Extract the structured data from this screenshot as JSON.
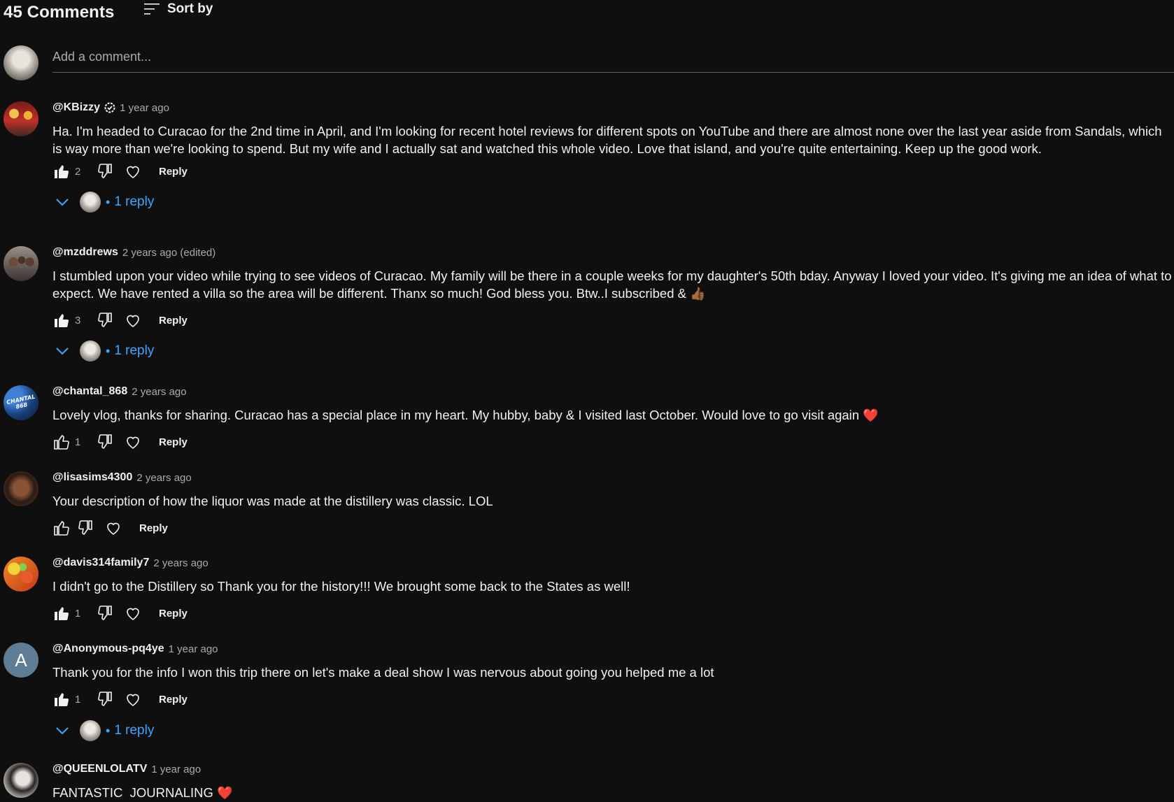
{
  "header": {
    "count_label": "45 Comments",
    "sort_label": "Sort by"
  },
  "add_comment": {
    "placeholder": "Add a comment..."
  },
  "comments": [
    {
      "author": "@KBizzy",
      "verified": true,
      "time": "1 year ago",
      "text": "Ha. I'm headed to Curacao for the 2nd time in April, and I'm looking for recent hotel reviews for different spots on YouTube and there are almost none over the last year aside from Sandals, which is way more than we're looking to spend. But my wife and I actually sat and watched this whole video. Love that island, and you're quite entertaining. Keep up the good work.",
      "likes": "2",
      "liked": true,
      "reply_label": "Reply",
      "replies_label": "1 reply",
      "avatar_icon": "cartoon-avatar"
    },
    {
      "author": "@mzddrews",
      "verified": false,
      "time": "2 years ago (edited)",
      "text": "I stumbled upon your video while trying to see videos of Curacao. My family will be there in a couple weeks for my daughter's 50th bday. Anyway I loved your video. It's giving me an idea of what to expect. We have rented a villa so the area will be different. Thanx so much! God bless you. Btw..I subscribed &",
      "emoji": "👍🏾",
      "likes": "3",
      "liked": true,
      "reply_label": "Reply",
      "replies_label": "1 reply",
      "avatar_icon": "group-photo-avatar"
    },
    {
      "author": "@chantal_868",
      "verified": false,
      "time": "2 years ago",
      "text": "Lovely vlog, thanks for sharing. Curacao has a special place in my heart. My hubby, baby & I visited last October. Would love to go visit again",
      "emoji": "❤️",
      "likes": "1",
      "liked": false,
      "reply_label": "Reply",
      "avatar_icon": "chantal-logo-avatar",
      "avatar_text": "CHANTAL 868"
    },
    {
      "author": "@lisasims4300",
      "verified": false,
      "time": "2 years ago",
      "text": "Your description of how the liquor was made at the distillery was classic. LOL",
      "likes": "",
      "liked": false,
      "reply_label": "Reply",
      "avatar_icon": "portrait-avatar"
    },
    {
      "author": "@davis314family7",
      "verified": false,
      "time": "2 years ago",
      "text": "I didn't go to the Distillery so Thank you for the history!!! We brought some back to the States as well!",
      "likes": "1",
      "liked": true,
      "reply_label": "Reply",
      "avatar_icon": "colorful-avatar"
    },
    {
      "author": "@Anonymous-pq4ye",
      "verified": false,
      "time": "1 year ago",
      "text": "Thank you for the info I won this trip there on let's make a deal show I was nervous about going you helped me a lot",
      "likes": "1",
      "liked": true,
      "reply_label": "Reply",
      "replies_label": "1 reply",
      "avatar_icon": "letter-avatar",
      "avatar_letter": "A"
    },
    {
      "author": "@QUEENLOLATV",
      "verified": false,
      "time": "1 year ago",
      "text": "FANTASTIC  JOURNALING",
      "emoji": "❤️",
      "avatar_icon": "portrait-avatar"
    }
  ],
  "colors": {
    "background": "#0f0f0f",
    "text": "#f1f1f1",
    "secondary": "#aaaaaa",
    "link": "#3ea6ff"
  }
}
